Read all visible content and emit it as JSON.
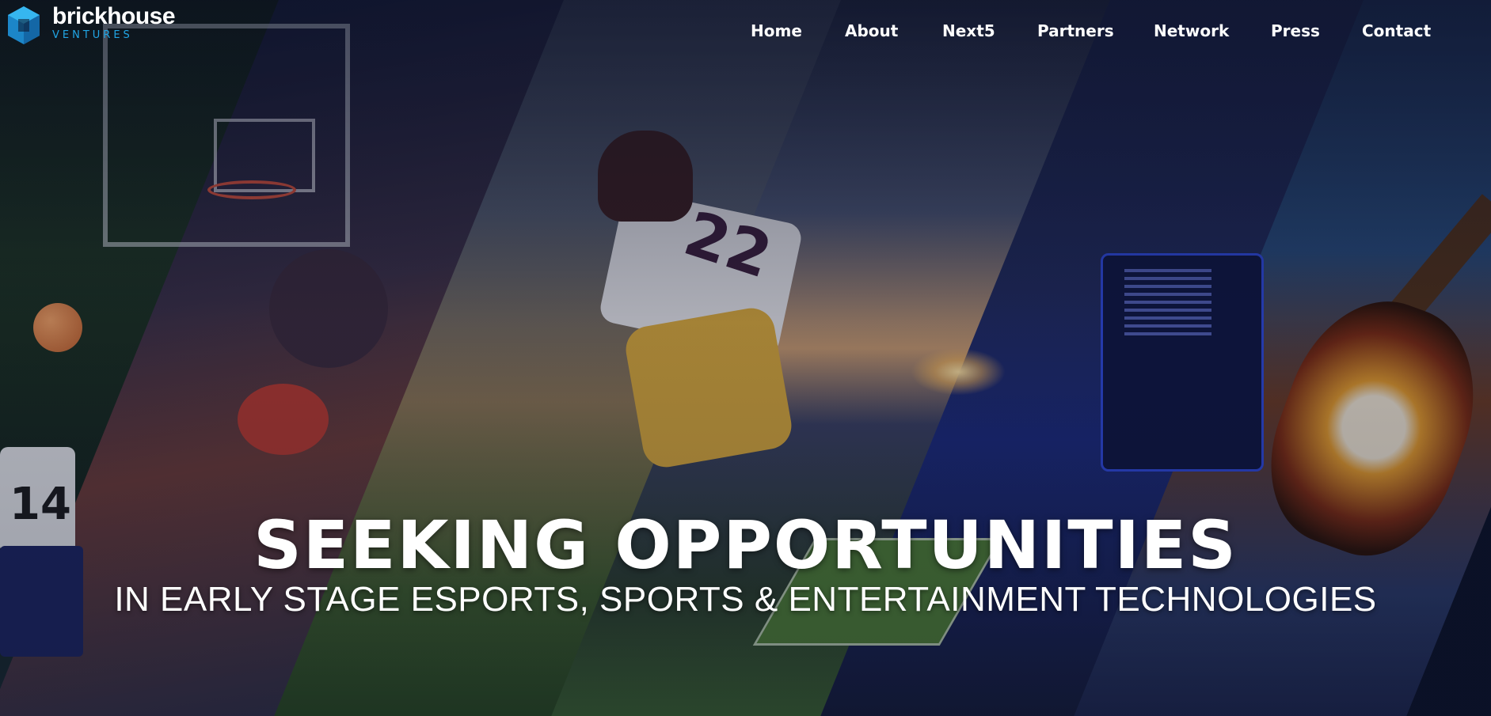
{
  "brand": {
    "name": "brickhouse",
    "tagline": "VENTURES",
    "accent_color": "#21a6e6"
  },
  "nav": {
    "items": [
      {
        "label": "Home"
      },
      {
        "label": "About"
      },
      {
        "label": "Next5"
      },
      {
        "label": "Partners"
      },
      {
        "label": "Network"
      },
      {
        "label": "Press"
      },
      {
        "label": "Contact"
      }
    ]
  },
  "hero": {
    "headline": "SEEKING OPPORTUNITIES",
    "subheadline": "IN EARLY STAGE ESPORTS, SPORTS & ENTERTAINMENT TECHNOLOGIES",
    "jersey_number_basketball": "14",
    "jersey_number_football": "22"
  }
}
